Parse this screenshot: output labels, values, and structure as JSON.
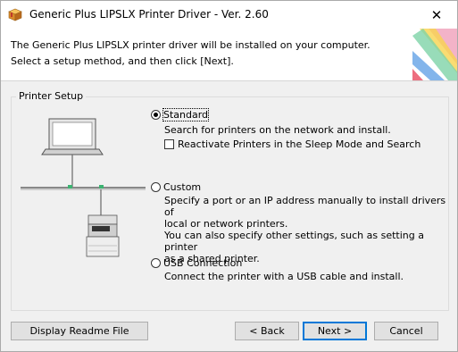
{
  "window": {
    "title": "Generic Plus LIPSLX Printer Driver - Ver. 2.60",
    "close_glyph": "✕"
  },
  "header": {
    "line1": "The Generic Plus LIPSLX printer driver will be installed on your computer.",
    "line2": "Select a setup method, and then click [Next]."
  },
  "printer_setup": {
    "group_label": "Printer Setup",
    "options": [
      {
        "label": "Standard",
        "selected": true,
        "description": [
          "Search for printers on the network and install."
        ],
        "checkbox": {
          "label": "Reactivate Printers in the Sleep Mode and Search",
          "checked": false
        }
      },
      {
        "label": "Custom",
        "selected": false,
        "description": [
          "Specify a port or an IP address manually to install drivers of",
          "local or network printers.",
          "You can also specify other settings, such as setting a printer",
          "as a shared printer."
        ]
      },
      {
        "label": "USB Connection",
        "selected": false,
        "description": [
          "Connect the printer with a USB cable and install."
        ]
      }
    ]
  },
  "buttons": {
    "readme": "Display Readme File",
    "back": "< Back",
    "next": "Next >",
    "cancel": "Cancel"
  },
  "icons": {
    "title_icon": "package-box-icon",
    "illustration": "network-printer-illustration"
  }
}
